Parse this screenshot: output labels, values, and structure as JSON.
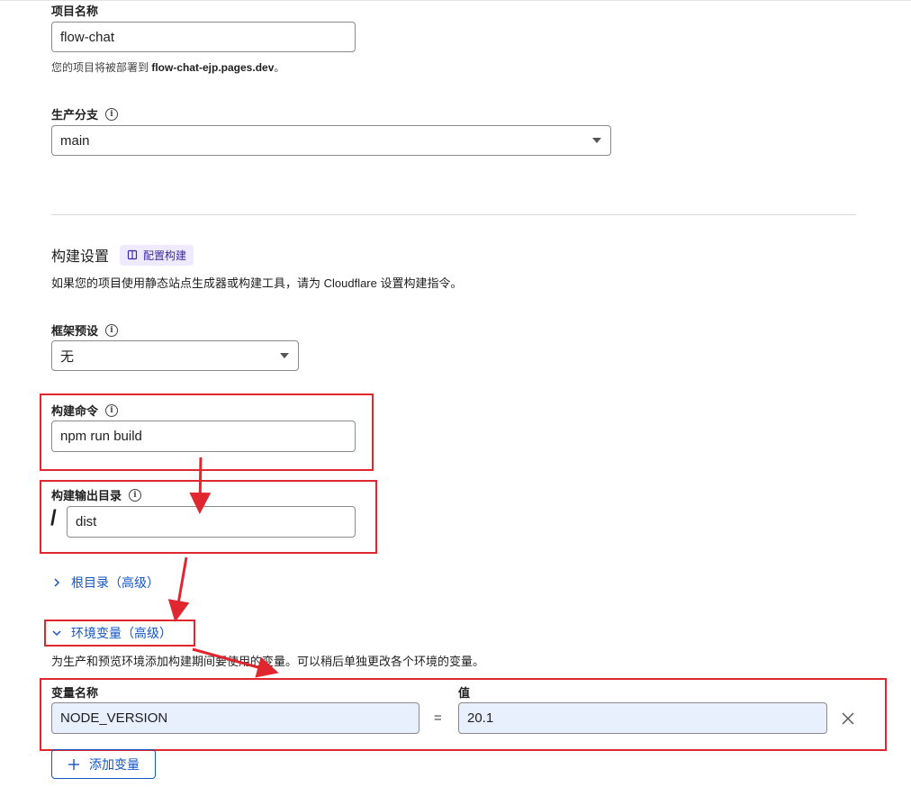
{
  "project_name": {
    "label": "项目名称",
    "value": "flow-chat",
    "hint_prefix": "您的项目将被部署到 ",
    "hint_domain": "flow-chat-ejp.pages.dev",
    "hint_suffix": "。"
  },
  "production_branch": {
    "label": "生产分支",
    "value": "main"
  },
  "build_settings": {
    "title": "构建设置",
    "badge_label": "配置构建",
    "description": "如果您的项目使用静态站点生成器或构建工具，请为 Cloudflare 设置构建指令。"
  },
  "framework_preset": {
    "label": "框架预设",
    "value": "无"
  },
  "build_command": {
    "label": "构建命令",
    "value": "npm run build"
  },
  "build_output": {
    "label": "构建输出目录",
    "prefix": "/",
    "value": "dist"
  },
  "root_dir_toggle": {
    "label": "根目录（高级）"
  },
  "env_vars": {
    "toggle_label": "环境变量（高级）",
    "description": "为生产和预览环境添加构建期间要使用的变量。可以稍后单独更改各个环境的变量。",
    "name_header": "变量名称",
    "value_header": "值",
    "equals": "=",
    "rows": [
      {
        "name": "NODE_VERSION",
        "value": "20.1"
      }
    ],
    "add_button_label": "添加变量"
  },
  "colors": {
    "annotation_red": "#e0262f",
    "link_blue": "#1556c5",
    "autofill_bg": "#e8f0fe"
  }
}
